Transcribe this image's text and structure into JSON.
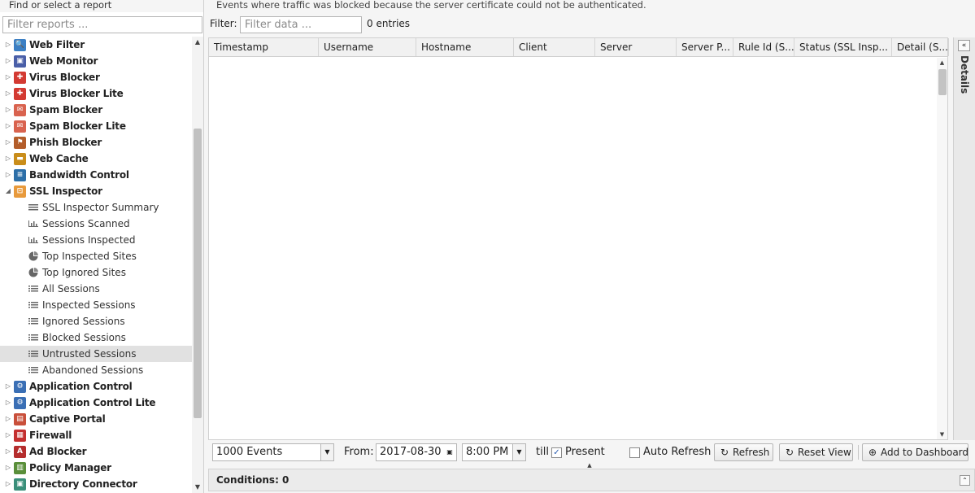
{
  "sidebar": {
    "header": "Find or select a report",
    "filter_placeholder": "Filter reports ...",
    "apps_top": [
      {
        "label": "Web Filter",
        "icon": "web-filter-icon",
        "color": "#3b7fc4",
        "glyph": "🔍"
      },
      {
        "label": "Web Monitor",
        "icon": "web-monitor-icon",
        "color": "#4a5fa8",
        "glyph": "▣"
      },
      {
        "label": "Virus Blocker",
        "icon": "virus-blocker-icon",
        "color": "#d33a32",
        "glyph": "✚"
      },
      {
        "label": "Virus Blocker Lite",
        "icon": "virus-blocker-lite-icon",
        "color": "#d33a32",
        "glyph": "✚"
      },
      {
        "label": "Spam Blocker",
        "icon": "spam-blocker-icon",
        "color": "#d9634f",
        "glyph": "✉"
      },
      {
        "label": "Spam Blocker Lite",
        "icon": "spam-blocker-lite-icon",
        "color": "#d9634f",
        "glyph": "✉"
      },
      {
        "label": "Phish Blocker",
        "icon": "phish-blocker-icon",
        "color": "#b35d2a",
        "glyph": "⚑"
      },
      {
        "label": "Web Cache",
        "icon": "web-cache-icon",
        "color": "#c98d1a",
        "glyph": "▬"
      },
      {
        "label": "Bandwidth Control",
        "icon": "bandwidth-control-icon",
        "color": "#2d6fa8",
        "glyph": "≡"
      },
      {
        "label": "SSL Inspector",
        "icon": "ssl-inspector-icon",
        "color": "#e89a3c",
        "glyph": "⊡"
      }
    ],
    "ssl_children": [
      {
        "label": "SSL Inspector Summary",
        "icon": "summary-text-icon"
      },
      {
        "label": "Sessions Scanned",
        "icon": "bar-chart-icon"
      },
      {
        "label": "Sessions Inspected",
        "icon": "bar-chart-icon"
      },
      {
        "label": "Top Inspected Sites",
        "icon": "pie-chart-icon"
      },
      {
        "label": "Top Ignored Sites",
        "icon": "pie-chart-icon"
      },
      {
        "label": "All Sessions",
        "icon": "list-icon"
      },
      {
        "label": "Inspected Sessions",
        "icon": "list-icon"
      },
      {
        "label": "Ignored Sessions",
        "icon": "list-icon"
      },
      {
        "label": "Blocked Sessions",
        "icon": "list-icon"
      },
      {
        "label": "Untrusted Sessions",
        "icon": "list-icon"
      },
      {
        "label": "Abandoned Sessions",
        "icon": "list-icon"
      }
    ],
    "apps_bottom": [
      {
        "label": "Application Control",
        "icon": "application-control-icon",
        "color": "#3a6fb5",
        "glyph": "⚙"
      },
      {
        "label": "Application Control Lite",
        "icon": "application-control-lite-icon",
        "color": "#3a6fb5",
        "glyph": "⚙"
      },
      {
        "label": "Captive Portal",
        "icon": "captive-portal-icon",
        "color": "#c9503b",
        "glyph": "▤"
      },
      {
        "label": "Firewall",
        "icon": "firewall-icon",
        "color": "#c42f2f",
        "glyph": "▦"
      },
      {
        "label": "Ad Blocker",
        "icon": "ad-blocker-icon",
        "color": "#b52d2d",
        "glyph": "A"
      },
      {
        "label": "Policy Manager",
        "icon": "policy-manager-icon",
        "color": "#5a8f3a",
        "glyph": "▥"
      },
      {
        "label": "Directory Connector",
        "icon": "directory-connector-icon",
        "color": "#3a8f7a",
        "glyph": "▣"
      }
    ]
  },
  "main": {
    "description": "Events where traffic was blocked because the server certificate could not be authenticated.",
    "filter_label": "Filter:",
    "filter_placeholder": "Filter data ...",
    "entries": "0 entries",
    "columns": [
      "Timestamp",
      "Username",
      "Hostname",
      "Client",
      "Server",
      "Server P...",
      "Rule Id (S...",
      "Status (SSL Insp...",
      "Detail (S..."
    ],
    "details_label": "Details"
  },
  "toolbar": {
    "events_select": "1000 Events",
    "from_label": "From:",
    "from_date": "2017-08-30",
    "from_time": "8:00 PM",
    "till_label": "till",
    "present_label": "Present",
    "present_checked": true,
    "auto_refresh_label": "Auto Refresh",
    "auto_refresh_checked": false,
    "refresh_label": "Refresh",
    "reset_view_label": "Reset View",
    "add_dashboard_label": "Add to Dashboard"
  },
  "conditions": {
    "label": "Conditions: 0"
  }
}
